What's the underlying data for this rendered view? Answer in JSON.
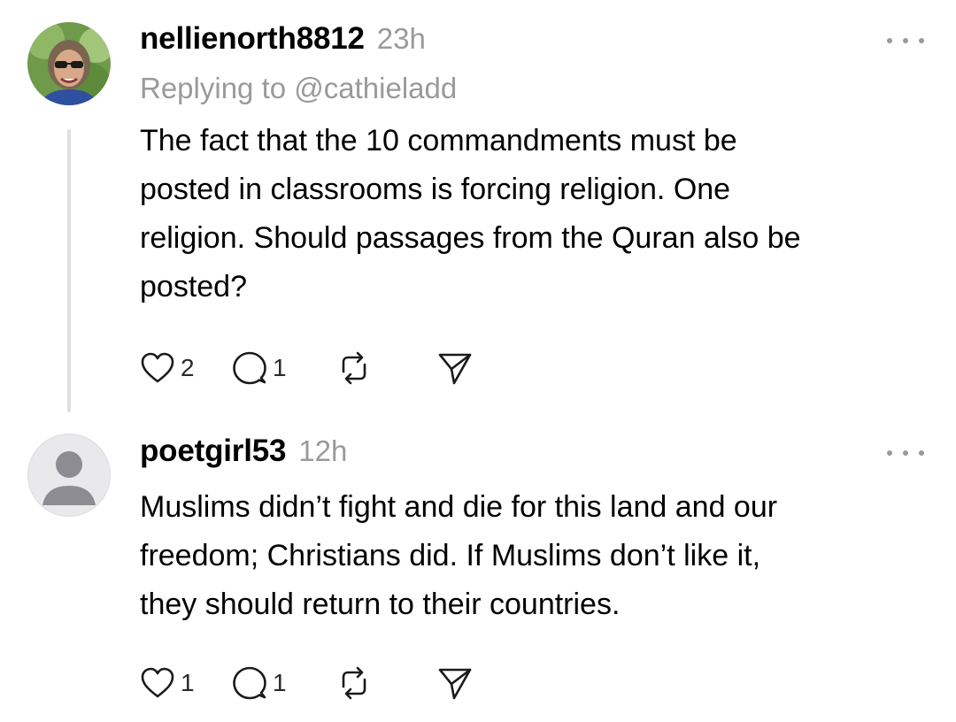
{
  "comments": [
    {
      "username": "nellienorth8812",
      "time": "23h",
      "replying_to": "Replying to @cathieladd",
      "lines": [
        "The fact that the 10 commandments must be",
        "posted in classrooms is forcing religion. One",
        "religion. Should passages from the Quran also be",
        "posted?"
      ],
      "likes": "2",
      "replies": "1",
      "avatar_icon": "profile-photo"
    },
    {
      "username": "poetgirl53",
      "time": "12h",
      "lines": [
        "Muslims didn’t fight and die for this land and our",
        "freedom; Christians did. If Muslims don’t like it,",
        "they should return to their countries."
      ],
      "likes": "1",
      "replies": "1",
      "avatar_icon": "default-user-icon"
    }
  ],
  "icons": {
    "like": "heart-icon",
    "reply": "comment-icon",
    "repost": "repost-icon",
    "share": "send-icon",
    "more": "more-options-icon"
  },
  "colors": {
    "text": "#000000",
    "muted": "#9a9a9a",
    "thread_line": "#e0e0e0"
  }
}
